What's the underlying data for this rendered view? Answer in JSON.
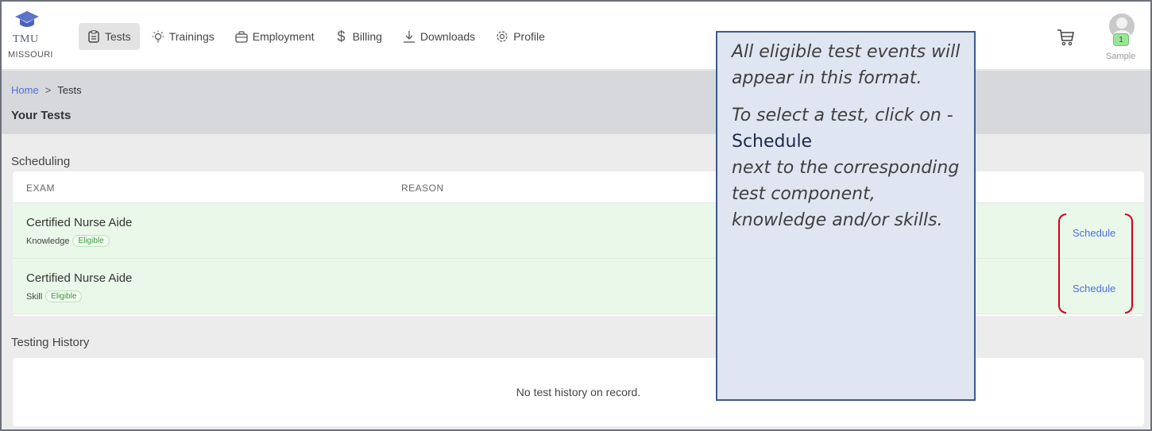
{
  "brand": {
    "name": "TMU",
    "state": "MISSOURI"
  },
  "nav": {
    "items": [
      {
        "label": "Tests",
        "icon": "clipboard-icon",
        "active": true
      },
      {
        "label": "Trainings",
        "icon": "lightbulb-icon",
        "active": false
      },
      {
        "label": "Employment",
        "icon": "briefcase-icon",
        "active": false
      },
      {
        "label": "Billing",
        "icon": "dollar-icon",
        "active": false
      },
      {
        "label": "Downloads",
        "icon": "download-icon",
        "active": false
      },
      {
        "label": "Profile",
        "icon": "gear-icon",
        "active": false
      }
    ]
  },
  "user": {
    "name": "Sample",
    "notification_count": "1",
    "cart_icon": "cart-icon",
    "avatar_icon": "avatar-icon"
  },
  "breadcrumb": {
    "home": "Home",
    "separator": ">",
    "current": "Tests"
  },
  "page": {
    "title": "Your Tests"
  },
  "scheduling": {
    "label": "Scheduling",
    "columns": [
      "EXAM",
      "REASON"
    ],
    "rows": [
      {
        "exam": "Certified Nurse Aide",
        "component": "Knowledge",
        "status": "Eligible",
        "action": "Schedule"
      },
      {
        "exam": "Certified Nurse Aide",
        "component": "Skill",
        "status": "Eligible",
        "action": "Schedule"
      }
    ]
  },
  "history": {
    "label": "Testing History",
    "empty": "No test history on record."
  },
  "callout": {
    "line1": "All eligible test events will appear in this format.",
    "line2": "To select a test, click on -",
    "keyword": "Schedule",
    "line3": "next to the corresponding test component, knowledge and/or skills."
  },
  "colors": {
    "accent": "#4f6edb",
    "eligible_row": "#eaf8ea",
    "highlight": "#d0021b",
    "callout_bg": "#dfe5f1",
    "callout_border": "#3d5b87"
  }
}
